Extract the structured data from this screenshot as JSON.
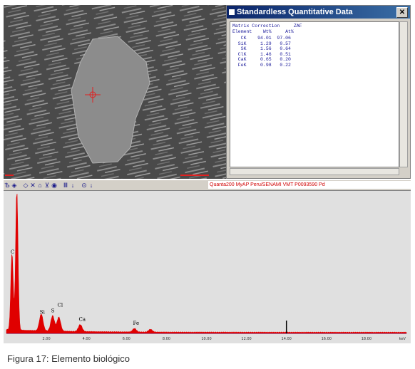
{
  "sem_image": {
    "scale_bar": ""
  },
  "quant_window": {
    "title": "Standardless Quantitative Data",
    "header_line1": "Matrix Correction     ZAF",
    "header_line2": "Element    Wt%     At%",
    "rows": [
      {
        "element": "CK",
        "wt": "94.01",
        "at": "97.06"
      },
      {
        "element": "SiK",
        "wt": "1.29",
        "at": "0.57"
      },
      {
        "element": "SK",
        "wt": "1.56",
        "at": "0.64"
      },
      {
        "element": "ClK",
        "wt": "1.46",
        "at": "0.51"
      },
      {
        "element": "CaK",
        "wt": "0.65",
        "at": "0.20"
      },
      {
        "element": "FeK",
        "wt": "0.98",
        "at": "0.22"
      }
    ],
    "close_glyph": "✕"
  },
  "toolbar": {
    "icons": [
      "Ѣ",
      "◈",
      "◇",
      "✕",
      "⌂",
      "⊻",
      "◉",
      "Ⅲ",
      "↓",
      "⊙",
      "↓"
    ],
    "path_text": "Quanta200 MyAP Peru/SENAMI VMT P0093590 Pd"
  },
  "chart_data": {
    "type": "line",
    "title": "",
    "xlabel": "keV",
    "ylabel": "",
    "xlim": [
      0,
      20
    ],
    "x_ticks": [
      "2.00",
      "4.00",
      "6.00",
      "8.00",
      "10.00",
      "12.00",
      "14.00",
      "16.00",
      "18.00",
      "keV"
    ],
    "peak_labels": [
      {
        "label": "C",
        "x": 0.28,
        "y": 0.55
      },
      {
        "label": "Si",
        "x": 1.74,
        "y": 0.12
      },
      {
        "label": "S",
        "x": 2.31,
        "y": 0.13
      },
      {
        "label": "Cl",
        "x": 2.62,
        "y": 0.17
      },
      {
        "label": "Ca",
        "x": 3.69,
        "y": 0.07
      },
      {
        "label": "Fe",
        "x": 6.4,
        "y": 0.04
      }
    ],
    "peaks": [
      {
        "x": 0.28,
        "height": 0.55
      },
      {
        "x": 0.52,
        "height": 1.0
      },
      {
        "x": 1.74,
        "height": 0.12
      },
      {
        "x": 2.31,
        "height": 0.11
      },
      {
        "x": 2.62,
        "height": 0.1
      },
      {
        "x": 3.69,
        "height": 0.05
      },
      {
        "x": 6.4,
        "height": 0.025
      },
      {
        "x": 7.2,
        "height": 0.02
      }
    ],
    "marker_x": 14.0,
    "colors": {
      "spectrum": "#e00000",
      "axis_line": "#6060c0",
      "background": "#e0e0e0"
    }
  },
  "caption": {
    "label": "Figura 17:",
    "text": "Elemento biológico"
  }
}
